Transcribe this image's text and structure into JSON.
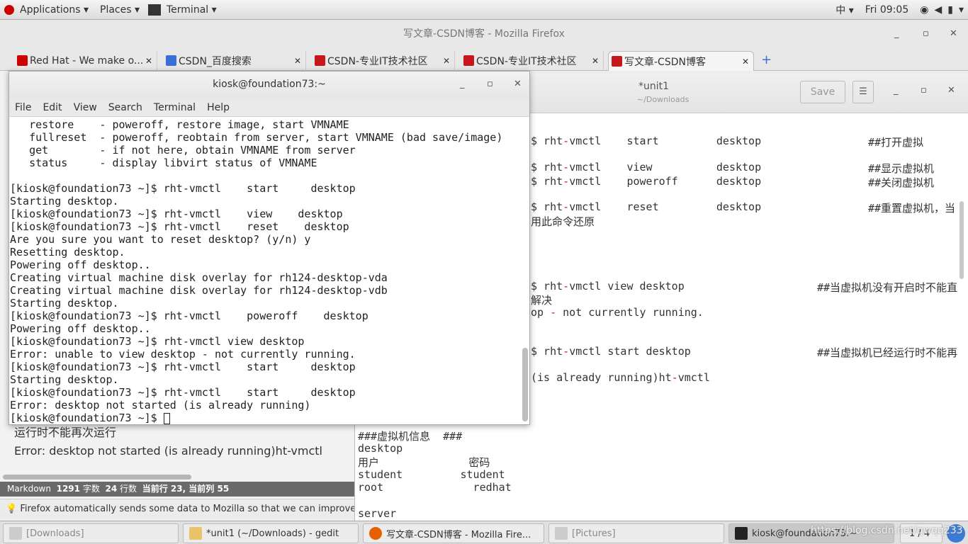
{
  "topbar": {
    "applications": "Applications ▾",
    "places": "Places ▾",
    "terminal": "Terminal ▾",
    "input_method": "中 ▾",
    "clock": "Fri 09:05"
  },
  "firefox": {
    "title": "写文章-CSDN博客 - Mozilla Firefox",
    "tabs": [
      {
        "label": "Red Hat - We make o...",
        "color": "#cc0000"
      },
      {
        "label": "CSDN_百度搜索",
        "color": "#3a6fd8"
      },
      {
        "label": "CSDN-专业IT技术社区",
        "color": "#c8161d"
      },
      {
        "label": "CSDN-专业IT技术社区",
        "color": "#c8161d"
      },
      {
        "label": "写文章-CSDN博客",
        "color": "#c8161d"
      }
    ],
    "editor_lines": [
      "运行时不能再次运行",
      "Error: desktop not started (is already running)ht-vmctl"
    ],
    "status": {
      "mode": "Markdown",
      "chars": "1291",
      "chars_label": "字数",
      "lines": "24",
      "lines_label": "行数",
      "cursor": "当前行 23, 当前列 55"
    },
    "notification": "Firefox automatically sends some data to Mozilla so that we can improve"
  },
  "gedit": {
    "title": "*unit1",
    "subtitle": "~/Downloads",
    "save": "Save",
    "lines_right": [
      {
        "cmd": "$ rht-vmctl    start         desktop",
        "comment": "##打开虚拟"
      },
      {
        "cmd": "$ rht-vmctl    view          desktop",
        "comment": "##显示虚拟机"
      },
      {
        "cmd": "$ rht-vmctl    poweroff      desktop",
        "comment": "##关闭虚拟机"
      },
      {
        "cmd": "$ rht-vmctl    reset         desktop",
        "comment": "##重置虚拟机，当"
      },
      {
        "cmd": "用此命令还原",
        "comment": ""
      },
      {
        "cmd": "$ rht-vmctl view desktop",
        "comment": "##当虚拟机没有开启时不能直"
      },
      {
        "cmd": "解决",
        "comment": ""
      },
      {
        "cmd": "op - not currently running.",
        "comment": ""
      },
      {
        "cmd": "$ rht-vmctl start desktop",
        "comment": "##当虚拟机已经运行时不能再"
      },
      {
        "cmd": "(is already running)ht-vmctl",
        "comment": ""
      }
    ],
    "lines_bottom": [
      "###虚拟机信息  ###",
      "desktop",
      "用户              密码",
      "student         student",
      "root              redhat",
      "",
      "server"
    ]
  },
  "terminal": {
    "title": "kiosk@foundation73:~",
    "menu": [
      "File",
      "Edit",
      "View",
      "Search",
      "Terminal",
      "Help"
    ],
    "lines": [
      "   restore    - poweroff, restore image, start VMNAME",
      "   fullreset  - poweroff, reobtain from server, start VMNAME (bad save/image)",
      "   get        - if not here, obtain VMNAME from server",
      "   status     - display libvirt status of VMNAME",
      "",
      "[kiosk@foundation73 ~]$ rht-vmctl    start     desktop",
      "Starting desktop.",
      "[kiosk@foundation73 ~]$ rht-vmctl    view    desktop",
      "[kiosk@foundation73 ~]$ rht-vmctl    reset    desktop",
      "Are you sure you want to reset desktop? (y/n) y",
      "Resetting desktop.",
      "Powering off desktop..",
      "Creating virtual machine disk overlay for rh124-desktop-vda",
      "Creating virtual machine disk overlay for rh124-desktop-vdb",
      "Starting desktop.",
      "[kiosk@foundation73 ~]$ rht-vmctl    poweroff    desktop",
      "Powering off desktop..",
      "[kiosk@foundation73 ~]$ rht-vmctl view desktop",
      "Error: unable to view desktop - not currently running.",
      "[kiosk@foundation73 ~]$ rht-vmctl    start     desktop",
      "Starting desktop.",
      "[kiosk@foundation73 ~]$ rht-vmctl    start     desktop",
      "Error: desktop not started (is already running)",
      "[kiosk@foundation73 ~]$ "
    ]
  },
  "taskbar": {
    "items": [
      "[Downloads]",
      "*unit1 (~/Downloads) - gedit",
      "写文章-CSDN博客 - Mozilla Fire...",
      "[Pictures]",
      "kiosk@foundation73:~"
    ],
    "pager": "1 / 4",
    "watermark": "https://blog.csdn.net/qwqq233"
  }
}
